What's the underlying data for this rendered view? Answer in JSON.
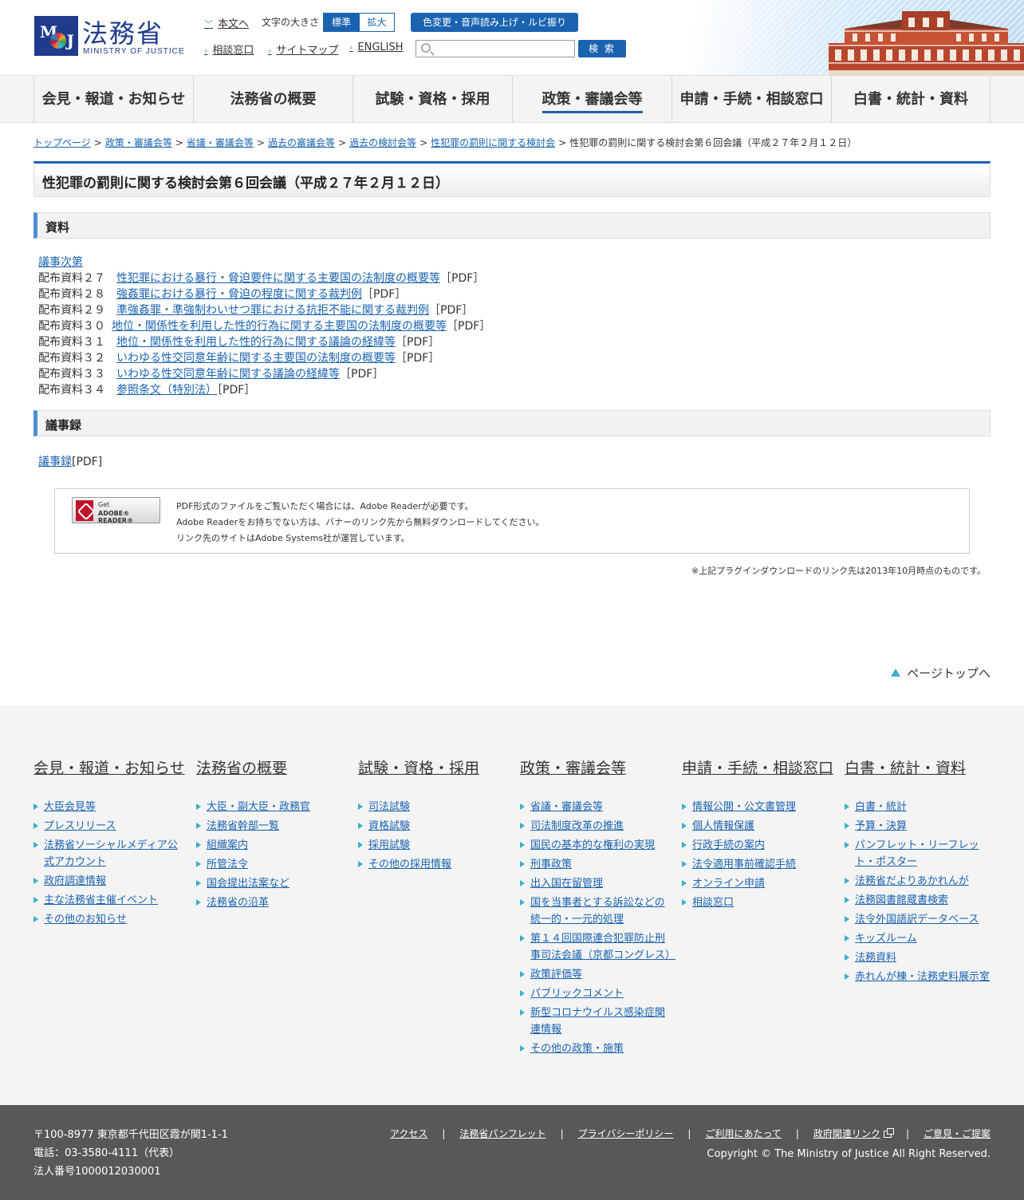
{
  "header": {
    "logo_name": "法務省",
    "logo_en": "MINISTRY OF JUSTICE",
    "skip_link": "本文へ",
    "font_size_label": "文字の大きさ",
    "font_standard": "標準",
    "font_large": "拡大",
    "color_button": "色変更・音声読み上げ・ルビ振り",
    "consult_link": "相談窓口",
    "sitemap_link": "サイトマップ",
    "english_link": "ENGLISH",
    "search_placeholder": "",
    "search_button": "検 索"
  },
  "nav": [
    {
      "label": "会見・報道・お知らせ"
    },
    {
      "label": "法務省の概要"
    },
    {
      "label": "試験・資格・採用"
    },
    {
      "label": "政策・審議会等"
    },
    {
      "label": "申請・手続・相談窓口"
    },
    {
      "label": "白書・統計・資料"
    }
  ],
  "breadcrumb": {
    "items": [
      "トップページ",
      "政策・審議会等",
      "省議・審議会等",
      "過去の審議会等",
      "過去の検討会等",
      "性犯罪の罰則に関する検討会"
    ],
    "current": "性犯罪の罰則に関する検討会第６回会議（平成２７年２月１２日）",
    "separator": ">"
  },
  "page_title": "性犯罪の罰則に関する検討会第６回会議（平成２７年２月１２日）",
  "materials": {
    "heading": "資料",
    "agenda": "議事次第",
    "docs": [
      {
        "label": "配布資料２７",
        "title": "性犯罪における暴行・脅迫要件に関する主要国の法制度の概要等",
        "pdf": "［PDF］"
      },
      {
        "label": "配布資料２８",
        "title": "強姦罪における暴行・脅迫の程度に関する裁判例",
        "pdf": "［PDF］"
      },
      {
        "label": "配布資料２９",
        "title": "準強姦罪・準強制わいせつ罪における抗拒不能に関する裁判例",
        "pdf": "［PDF］"
      },
      {
        "label": "配布資料３０",
        "title": "地位・関係性を利用した性的行為に関する主要国の法制度の概要等",
        "pdf": "［PDF］"
      },
      {
        "label": "配布資料３１",
        "title": "地位・関係性を利用した性的行為に関する議論の経緯等",
        "pdf": "［PDF］"
      },
      {
        "label": "配布資料３２",
        "title": "いわゆる性交同意年齢に関する主要国の法制度の概要等",
        "pdf": "［PDF］"
      },
      {
        "label": "配布資料３３",
        "title": "いわゆる性交同意年齢に関する議論の経緯等",
        "pdf": "［PDF］"
      },
      {
        "label": "配布資料３４",
        "title": "参照条文（特別法）",
        "pdf": "［PDF］"
      }
    ]
  },
  "minutes": {
    "heading": "議事録",
    "link": "議事録",
    "pdf": "[PDF]"
  },
  "adobe": {
    "badge_get": "Get",
    "badge_reader": "ADOBE® READER®",
    "line1": "PDF形式のファイルをご覧いただく場合には、Adobe Readerが必要です。",
    "line2": "Adobe Readerをお持ちでない方は、バナーのリンク先から無料ダウンロードしてください。",
    "line3": "リンク先のサイトはAdobe Systems社が運営しています。",
    "note": "※上記プラグインダウンロードのリンク先は2013年10月時点のものです。"
  },
  "pagetop": "ページトップへ",
  "sitemap": [
    {
      "title": "会見・報道・お知らせ",
      "links": [
        "大臣会見等",
        "プレスリリース",
        "法務省ソーシャルメディア公式アカウント",
        "政府調達情報",
        "主な法務省主催イベント",
        "その他のお知らせ"
      ]
    },
    {
      "title": "法務省の概要",
      "links": [
        "大臣・副大臣・政務官",
        "法務省幹部一覧",
        "組織案内",
        "所管法令",
        "国会提出法案など",
        "法務省の沿革"
      ]
    },
    {
      "title": "試験・資格・採用",
      "links": [
        "司法試験",
        "資格試験",
        "採用試験",
        "その他の採用情報"
      ]
    },
    {
      "title": "政策・審議会等",
      "links": [
        "省議・審議会等",
        "司法制度改革の推進",
        "国民の基本的な権利の実現",
        "刑事政策",
        "出入国在留管理",
        "国を当事者とする訴訟などの統一的・一元的処理",
        "第１４回国際連合犯罪防止刑事司法会議（京都コングレス）",
        "政策評価等",
        "パブリックコメント",
        "新型コロナウイルス感染症関連情報",
        "その他の政策・施策"
      ]
    },
    {
      "title": "申請・手続・相談窓口",
      "links": [
        "情報公開・公文書管理",
        "個人情報保護",
        "行政手続の案内",
        "法令適用事前確認手続",
        "オンライン申請",
        "相談窓口"
      ]
    },
    {
      "title": "白書・統計・資料",
      "links": [
        "白書・統計",
        "予算・決算",
        "パンフレット・リーフレット・ポスター",
        "法務省だよりあかれんが",
        "法務図書館蔵書検索",
        "法令外国語訳データベース",
        "キッズルーム",
        "法務資料",
        "赤れんが棟・法務史料展示室"
      ]
    }
  ],
  "footer": {
    "address": "〒100-8977 東京都千代田区霞が関1-1-1",
    "phone": "電話：03-3580-4111（代表）",
    "corp_number": "法人番号1000012030001",
    "links": [
      "アクセス",
      "法務省パンフレット",
      "プライバシーポリシー",
      "ご利用にあたって",
      "政府関連リンク",
      "ご意見・ご提案"
    ],
    "copyright": "Copyright © The Ministry of Justice All Right Reserved."
  },
  "colors": {
    "brand_blue": "#1a63b0",
    "logo_navy": "#1f3b8c",
    "accent_cyan": "#3aaecb",
    "footer_gray": "#585858"
  }
}
